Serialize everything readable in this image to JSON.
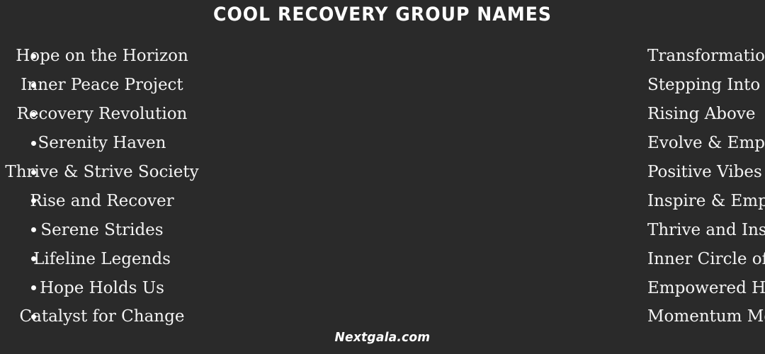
{
  "page": {
    "title": "Cool Recovery Group Names",
    "background_color": "#2a2a2a",
    "text_color": "#f4f4f4",
    "title_color": "#ffffff"
  },
  "columns": {
    "left": {
      "items": [
        {
          "label": "Hope on the Horizon"
        },
        {
          "label": "Inner Peace Project"
        },
        {
          "label": "Recovery Revolution"
        },
        {
          "label": "Serenity Haven"
        },
        {
          "label": "Thrive & Strive Society"
        },
        {
          "label": "Rise and Recover"
        },
        {
          "label": "Serene Strides"
        },
        {
          "label": "Lifeline Legends"
        },
        {
          "label": "Hope Holds Us"
        },
        {
          "label": "Catalyst for Change"
        }
      ]
    },
    "right": {
      "items": [
        {
          "label": "Transformation Titans"
        },
        {
          "label": "Stepping Into Serenity"
        },
        {
          "label": "Rising Above"
        },
        {
          "label": "Evolve & Empower Elite"
        },
        {
          "label": "Positive Vibes"
        },
        {
          "label": "Inspire & Empower Ensemble"
        },
        {
          "label": "Thrive and Inspire"
        },
        {
          "label": "Inner Circle of Cool"
        },
        {
          "label": "Empowered Healing"
        },
        {
          "label": "Momentum Menders"
        }
      ]
    }
  },
  "footer": {
    "watermark": "Nextgala.com"
  }
}
